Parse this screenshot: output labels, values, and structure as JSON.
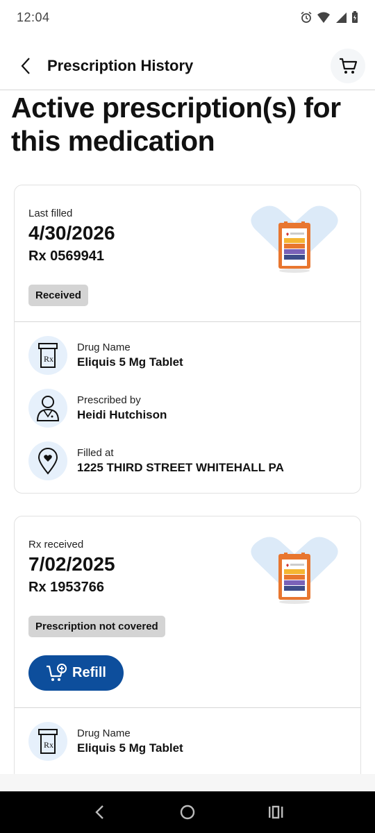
{
  "status_bar": {
    "time": "12:04"
  },
  "header": {
    "title": "Prescription History"
  },
  "page_title": "Active prescription(s) for this medication",
  "cards": [
    {
      "date_label": "Last filled",
      "date": "4/30/2026",
      "rx": "Rx 0569941",
      "status": "Received",
      "details": [
        {
          "icon": "rx-bottle-icon",
          "label": "Drug Name",
          "value": "Eliquis 5 Mg Tablet"
        },
        {
          "icon": "doctor-icon",
          "label": "Prescribed by",
          "value": "Heidi Hutchison"
        },
        {
          "icon": "location-pin-icon",
          "label": "Filled at",
          "value": "1225 THIRD STREET WHITEHALL PA"
        }
      ]
    },
    {
      "date_label": "Rx received",
      "date": "7/02/2025",
      "rx": "Rx 1953766",
      "status": "Prescription not covered",
      "refill_label": "Refill",
      "details": [
        {
          "icon": "rx-bottle-icon",
          "label": "Drug Name",
          "value": "Eliquis 5 Mg Tablet"
        }
      ]
    }
  ],
  "colors": {
    "primary": "#0d4e9c",
    "icon_bg": "#e6f0fb",
    "badge_bg": "#d4d4d4"
  }
}
